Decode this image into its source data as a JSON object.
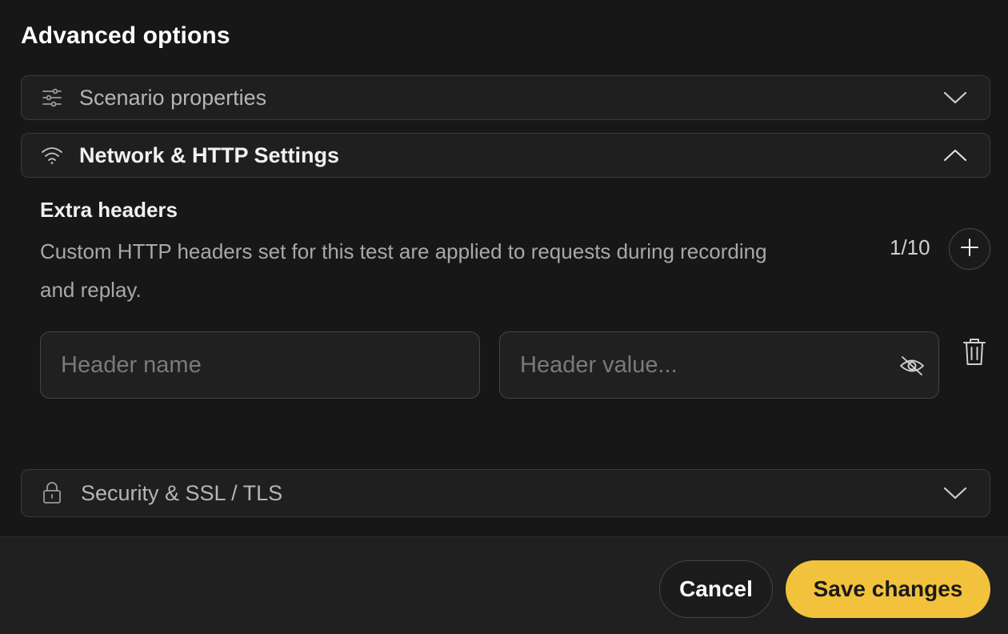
{
  "dialog": {
    "title": "Advanced options"
  },
  "sections": {
    "scenario": {
      "label": "Scenario properties",
      "icon": "sliders-icon",
      "expanded": false
    },
    "network": {
      "label": "Network & HTTP Settings",
      "icon": "wifi-icon",
      "expanded": true
    },
    "security": {
      "label": "Security & SSL / TLS",
      "icon": "lock-icon",
      "expanded": false
    }
  },
  "extra_headers": {
    "title": "Extra headers",
    "description": "Custom HTTP headers set for this test are applied to requests during recording and replay.",
    "counter": "1/10",
    "rows": [
      {
        "name_placeholder": "Header name",
        "name_value": "",
        "value_placeholder": "Header value...",
        "value_value": ""
      }
    ]
  },
  "footer": {
    "cancel_label": "Cancel",
    "save_label": "Save changes"
  },
  "colors": {
    "background": "#171717",
    "accent": "#f3c23c",
    "border": "#3a3a3a"
  }
}
